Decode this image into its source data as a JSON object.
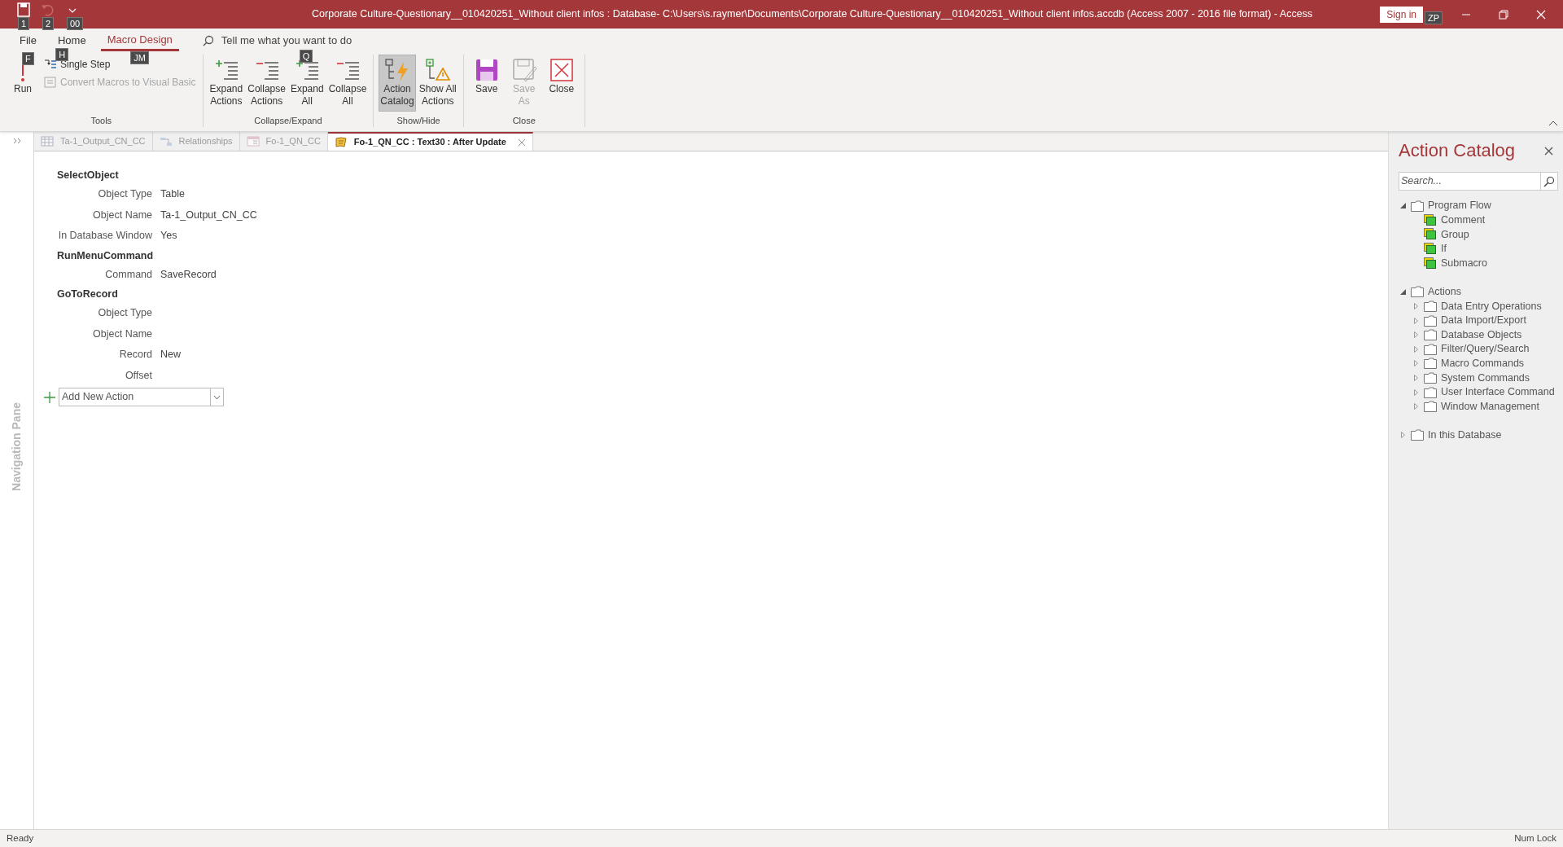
{
  "window": {
    "title": "Corporate Culture-Questionary__010420251_Without client infos : Database- C:\\Users\\s.raymer\\Documents\\Corporate Culture-Questionary__010420251_Without client infos.accdb (Access 2007 - 2016 file format)  -  Access",
    "sign_in": "Sign in",
    "sign_in_keytip": "ZP"
  },
  "quick_access": [
    {
      "kind": "save",
      "keytip": "1",
      "disabled": false
    },
    {
      "kind": "undo",
      "keytip": "2",
      "disabled": true
    },
    {
      "kind": "customize",
      "keytip": "00",
      "disabled": false
    }
  ],
  "ribbon_tabs": [
    {
      "label": "File",
      "keytip": "F",
      "selected": false
    },
    {
      "label": "Home",
      "keytip": "H",
      "selected": false
    },
    {
      "label": "Macro Design",
      "keytip": "JM",
      "selected": true
    }
  ],
  "tell_me": {
    "placeholder": "Tell me what you want to do",
    "keytip": "Q"
  },
  "ribbon_groups": [
    {
      "label": "Tools",
      "commands": [
        {
          "kind": "large",
          "label": "Run",
          "disabled": false
        },
        {
          "kind": "small",
          "label": "Single Step",
          "disabled": false
        },
        {
          "kind": "small",
          "label": "Convert Macros to Visual Basic",
          "disabled": true
        }
      ]
    },
    {
      "label": "Collapse/Expand",
      "commands": [
        {
          "kind": "large",
          "label": "Expand\nActions",
          "disabled": false
        },
        {
          "kind": "large",
          "label": "Collapse\nActions",
          "disabled": false
        },
        {
          "kind": "large",
          "label": "Expand\nAll",
          "disabled": false
        },
        {
          "kind": "large",
          "label": "Collapse\nAll",
          "disabled": false
        }
      ]
    },
    {
      "label": "Show/Hide",
      "commands": [
        {
          "kind": "toggle",
          "label": "Action\nCatalog",
          "disabled": false,
          "on": true
        },
        {
          "kind": "toggle",
          "label": "Show All\nActions",
          "disabled": false,
          "on": false
        }
      ]
    },
    {
      "label": "Close",
      "commands": [
        {
          "kind": "large",
          "label": "Save",
          "disabled": false
        },
        {
          "kind": "large",
          "label": "Save\nAs",
          "disabled": true
        },
        {
          "kind": "large",
          "label": "Close",
          "disabled": false
        }
      ]
    }
  ],
  "navigation_pane": {
    "label": "Navigation Pane"
  },
  "document_tabs": [
    {
      "label": "Ta-1_Output_CN_CC",
      "kind": "table",
      "selected": false
    },
    {
      "label": "Relationships",
      "kind": "relationships",
      "selected": false
    },
    {
      "label": "Fo-1_QN_CC",
      "kind": "form",
      "selected": false
    },
    {
      "label": "Fo-1_QN_CC : Text30 : After Update",
      "kind": "macro",
      "selected": true
    }
  ],
  "macro": {
    "actions": [
      {
        "name": "SelectObject",
        "arguments": [
          {
            "label": "Object Type",
            "value": "Table"
          },
          {
            "label": "Object Name",
            "value": "Ta-1_Output_CN_CC"
          },
          {
            "label": "In Database Window",
            "value": "Yes"
          }
        ]
      },
      {
        "name": "RunMenuCommand",
        "arguments": [
          {
            "label": "Command",
            "value": "SaveRecord"
          }
        ]
      },
      {
        "name": "GoToRecord",
        "arguments": [
          {
            "label": "Object Type"
          },
          {
            "label": "Object Name"
          },
          {
            "label": "Record",
            "value": "New"
          },
          {
            "label": "Offset"
          }
        ]
      }
    ],
    "add_action": {
      "placeholder": "Add New Action"
    }
  },
  "action_catalog": {
    "title": "Action Catalog",
    "search": {
      "placeholder": "Search..."
    },
    "tree": [
      {
        "label": "Program Flow",
        "kind": "folder",
        "expanded": true,
        "children": [
          {
            "label": "Comment",
            "kind": "flow"
          },
          {
            "label": "Group",
            "kind": "flow"
          },
          {
            "label": "If",
            "kind": "flow"
          },
          {
            "label": "Submacro",
            "kind": "flow"
          }
        ]
      },
      {
        "label": "Actions",
        "kind": "folder",
        "expanded": true,
        "children": [
          {
            "label": "Data Entry Operations",
            "kind": "folder",
            "expanded": false
          },
          {
            "label": "Data Import/Export",
            "kind": "folder",
            "expanded": false
          },
          {
            "label": "Database Objects",
            "kind": "folder",
            "expanded": false
          },
          {
            "label": "Filter/Query/Search",
            "kind": "folder",
            "expanded": false
          },
          {
            "label": "Macro Commands",
            "kind": "folder",
            "expanded": false
          },
          {
            "label": "System Commands",
            "kind": "folder",
            "expanded": false
          },
          {
            "label": "User Interface Command",
            "kind": "folder",
            "expanded": false
          },
          {
            "label": "Window Management",
            "kind": "folder",
            "expanded": false
          }
        ]
      },
      {
        "label": "In this Database",
        "kind": "folder",
        "expanded": false
      }
    ]
  },
  "status_bar": {
    "left": "Ready",
    "right": "Num Lock"
  }
}
